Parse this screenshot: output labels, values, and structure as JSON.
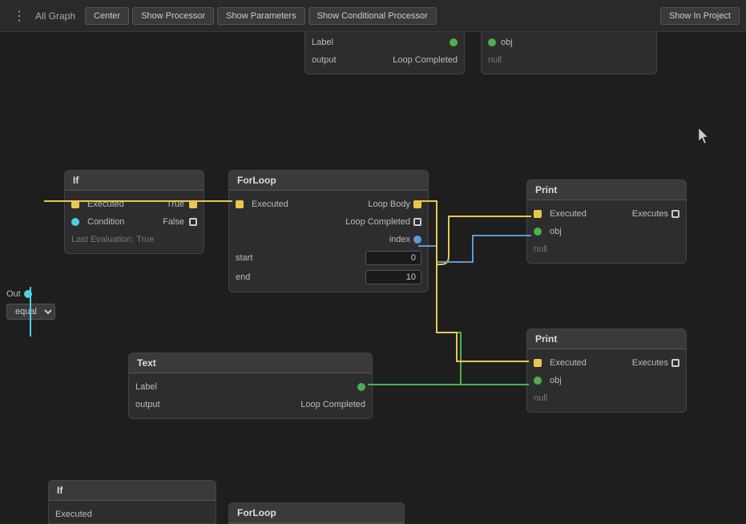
{
  "toolbar": {
    "title": "All Graph",
    "menu_icon": "⋮",
    "buttons": [
      "Center",
      "Show Processor",
      "Show Parameters",
      "Show Conditional Processor"
    ],
    "right_button": "Show In Project"
  },
  "nodes": {
    "if_node": {
      "title": "If",
      "executed_label": "Executed",
      "true_label": "True",
      "condition_label": "Condition",
      "false_label": "False",
      "last_eval_label": "Last Evaluation: True",
      "out_label": "Out",
      "equal_label": "equal"
    },
    "forloop_node": {
      "title": "ForLoop",
      "executed_label": "Executed",
      "loop_body_label": "Loop Body",
      "loop_completed_label": "Loop Completed",
      "index_label": "index",
      "start_label": "start",
      "start_value": "0",
      "end_label": "end",
      "end_value": "10"
    },
    "print_top": {
      "title": "Print",
      "executed_label": "Executed",
      "executes_label": "Executes",
      "obj_label": "obj",
      "null_label": "null"
    },
    "print_bottom": {
      "title": "Print",
      "executed_label": "Executed",
      "executes_label": "Executes",
      "obj_label": "obj",
      "null_label": "null"
    },
    "text_node": {
      "title": "Text",
      "label_label": "Label",
      "output_label": "output",
      "output_value": "Loop Completed"
    },
    "partial_top_right": {
      "label_label": "Label",
      "output_label": "output",
      "output_value": "Loop Completed",
      "obj_label": "obj",
      "null_label": "null"
    },
    "partial_if_left": {
      "title": "If",
      "executed_label": "Executed"
    },
    "partial_forloop_left": {
      "title": "ForLoop"
    }
  }
}
